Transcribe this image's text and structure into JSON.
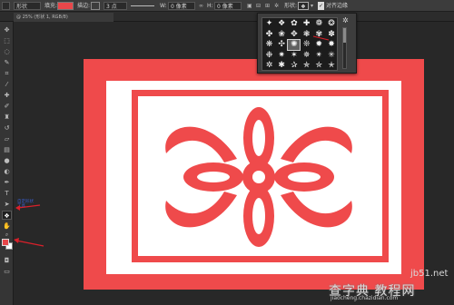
{
  "options_bar": {
    "tool_mode": "形状",
    "fill_label": "填充:",
    "fill_color": "#e8474a",
    "stroke_label": "描边:",
    "stroke_width": "3 点",
    "width_label": "W:",
    "width_value": "0 像素",
    "link_icon": "link-icon",
    "height_label": "H:",
    "height_value": "0 像素",
    "shape_label": "形状:",
    "align_edges_label": "对齐边缘"
  },
  "document_tab": {
    "title": "@ 25% (形状 1, RGB/8)",
    "close": "×"
  },
  "toolbar": {
    "tools": [
      "move",
      "marquee",
      "lasso",
      "quick-select",
      "crop",
      "eyedropper",
      "spot-heal",
      "brush",
      "stamp",
      "history-brush",
      "eraser",
      "gradient",
      "blur",
      "dodge",
      "pen",
      "type",
      "path-select",
      "custom-shape",
      "hand",
      "zoom"
    ],
    "active_tool": "custom-shape",
    "foreground_color": "#e8474a",
    "background_color": "#ffffff"
  },
  "canvas": {
    "background_color": "#ef4a4b",
    "border_color": "#ffffff",
    "pattern_color": "#ef4a4b"
  },
  "shape_picker": {
    "selected_index": 14,
    "cells": [
      "✦",
      "❖",
      "✿",
      "✚",
      "❁",
      "❂",
      "✤",
      "❀",
      "✥",
      "❃",
      "✾",
      "✽",
      "❋",
      "✣",
      "✺",
      "❊",
      "✹",
      "✸",
      "❉",
      "✷",
      "✶",
      "✵",
      "✴",
      "✳",
      "✲",
      "✱",
      "✰",
      "✯",
      "✮",
      "✭"
    ]
  },
  "annotation": {
    "text": "自定形状工具",
    "arrow_color": "#d9202a"
  },
  "watermark": {
    "domain": "jb51.net",
    "site": "查字典 教程网",
    "url": "jiaocheng.chazidian.com"
  }
}
